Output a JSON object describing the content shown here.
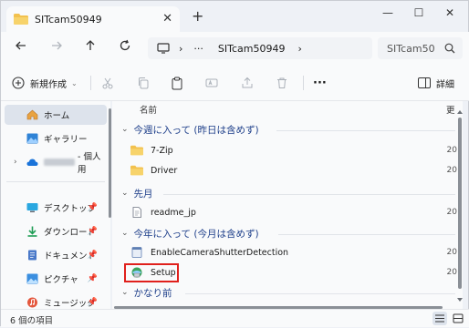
{
  "window": {
    "tab_title": "SITcam50949",
    "tab_close": "✕",
    "new_tab": "+",
    "min": "—",
    "max": "☐",
    "close": "✕"
  },
  "address": {
    "path_ellipsis": "···",
    "path_folder": "SITcam50949",
    "search_placeholder": "SITcam50"
  },
  "toolbar": {
    "new_label": "新規作成",
    "more": "···",
    "details_label": "詳細"
  },
  "nav": {
    "items": [
      {
        "label": "ホーム",
        "icon": "home-icon"
      },
      {
        "label": "ギャラリー",
        "icon": "gallery-icon"
      },
      {
        "label": "- 個人用",
        "icon": "onedrive-cloud-icon"
      },
      {
        "label": "デスクトップ",
        "icon": "desktop-icon"
      },
      {
        "label": "ダウンロード",
        "icon": "download-icon"
      },
      {
        "label": "ドキュメント",
        "icon": "documents-icon"
      },
      {
        "label": "ピクチャ",
        "icon": "pictures-icon"
      },
      {
        "label": "ミュージック",
        "icon": "music-icon"
      }
    ]
  },
  "content": {
    "col_name": "名前",
    "col_date": "更",
    "groups": [
      {
        "label": "今週に入って (昨日は含めず)",
        "rows": [
          {
            "name": "7-Zip",
            "date": "20",
            "type": "folder"
          },
          {
            "name": "Driver",
            "date": "20",
            "type": "folder"
          }
        ]
      },
      {
        "label": "先月",
        "rows": [
          {
            "name": "readme_jp",
            "date": "20",
            "type": "file"
          }
        ]
      },
      {
        "label": "今年に入って (今月は含めず)",
        "rows": [
          {
            "name": "EnableCameraShutterDetection",
            "date": "20",
            "type": "exe"
          },
          {
            "name": "Setup",
            "date": "20",
            "type": "setup"
          }
        ]
      },
      {
        "label": "かなり前",
        "rows": []
      }
    ]
  },
  "status": {
    "item_count": "6 個の項目"
  },
  "colors": {
    "accent": "#1e3f8a",
    "folder": "#f2c14e",
    "highlight": "#e0201c"
  }
}
